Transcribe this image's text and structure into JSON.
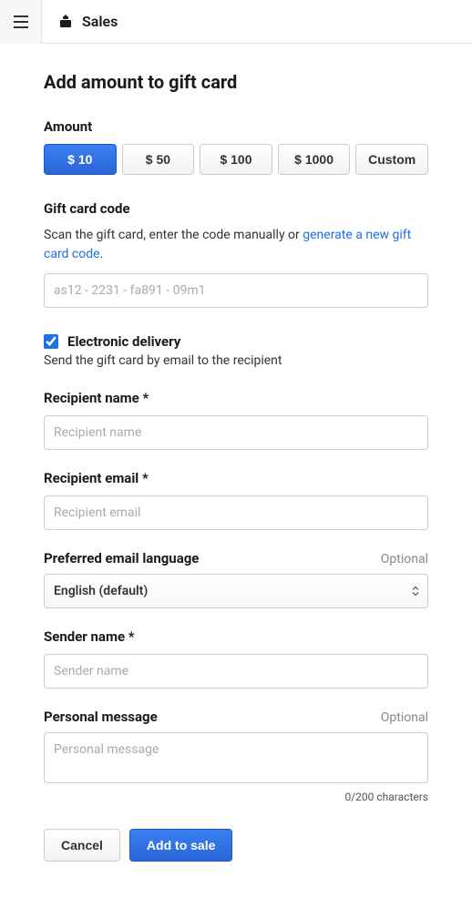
{
  "header": {
    "title": "Sales"
  },
  "page": {
    "title": "Add amount to gift card"
  },
  "amount": {
    "label": "Amount",
    "options": [
      "$ 10",
      "$ 50",
      "$ 100",
      "$ 1000",
      "Custom"
    ],
    "selectedIndex": 0
  },
  "giftCardCode": {
    "label": "Gift card code",
    "help_prefix": "Scan the gift card, enter the code manually or ",
    "help_link": "generate a new gift card code",
    "help_suffix": ".",
    "placeholder": "as12 - 2231 - fa891 - 09m1",
    "value": ""
  },
  "electronicDelivery": {
    "checked": true,
    "label": "Electronic delivery",
    "help": "Send the gift card by email to the recipient"
  },
  "recipientName": {
    "label": "Recipient name *",
    "placeholder": "Recipient name",
    "value": ""
  },
  "recipientEmail": {
    "label": "Recipient email *",
    "placeholder": "Recipient email",
    "value": ""
  },
  "preferredLanguage": {
    "label": "Preferred email language",
    "optional": "Optional",
    "selected": "English (default)"
  },
  "senderName": {
    "label": "Sender name *",
    "placeholder": "Sender name",
    "value": ""
  },
  "personalMessage": {
    "label": "Personal message",
    "optional": "Optional",
    "placeholder": "Personal message",
    "value": "",
    "charCount": "0/200 characters"
  },
  "actions": {
    "cancel": "Cancel",
    "submit": "Add to sale"
  }
}
